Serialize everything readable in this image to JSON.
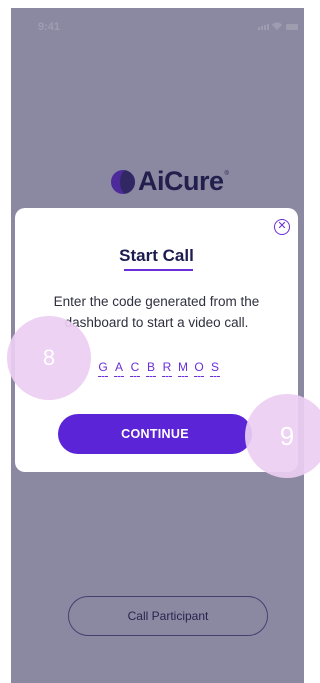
{
  "status_bar": {
    "time": "9:41"
  },
  "brand": {
    "name": "AiCure",
    "trademark": "®"
  },
  "background_button": {
    "label": "Call Participant"
  },
  "modal": {
    "close_icon": "close-icon",
    "title": "Start Call",
    "description": "Enter the code generated from the dashboard to start a video call.",
    "code": [
      "G",
      "A",
      "C",
      "B",
      "R",
      "M",
      "O",
      "S"
    ],
    "continue_label": "CONTINUE"
  },
  "annotations": {
    "badge_8": "8",
    "badge_9": "9"
  },
  "colors": {
    "accent": "#5b24d6",
    "overlay": "#4a4770",
    "badge": "#ecd0f2"
  }
}
